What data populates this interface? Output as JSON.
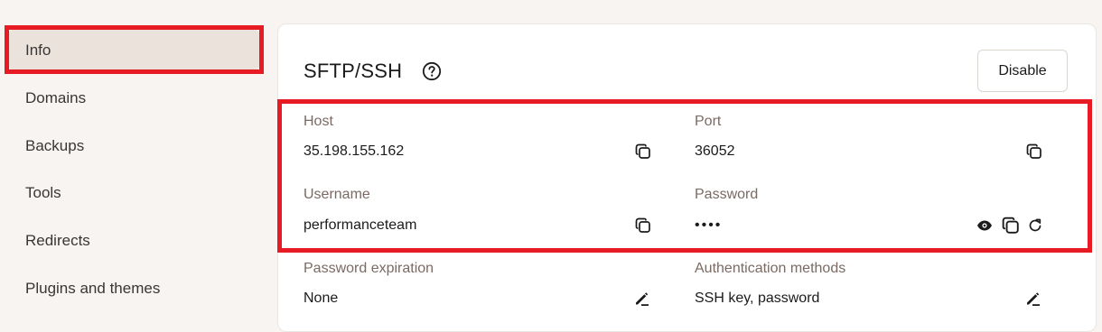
{
  "sidebar": {
    "items": [
      {
        "label": "Info"
      },
      {
        "label": "Domains"
      },
      {
        "label": "Backups"
      },
      {
        "label": "Tools"
      },
      {
        "label": "Redirects"
      },
      {
        "label": "Plugins and themes"
      }
    ],
    "active": "Info"
  },
  "section": {
    "title": "SFTP/SSH",
    "disable_label": "Disable"
  },
  "fields": {
    "host": {
      "label": "Host",
      "value": "35.198.155.162"
    },
    "port": {
      "label": "Port",
      "value": "36052"
    },
    "username": {
      "label": "Username",
      "value": "performanceteam"
    },
    "password": {
      "label": "Password",
      "value": "••••"
    },
    "password_expiration": {
      "label": "Password expiration",
      "value": "None"
    },
    "auth_methods": {
      "label": "Authentication methods",
      "value": "SSH key, password"
    }
  },
  "icons": {
    "copy": "copy-icon",
    "eye": "eye-icon",
    "refresh": "refresh-icon",
    "edit": "edit-icon",
    "help": "help-icon"
  },
  "colors": {
    "highlight": "#e61b23",
    "active_nav": "#ebe2dc",
    "label": "#7a6a63"
  }
}
